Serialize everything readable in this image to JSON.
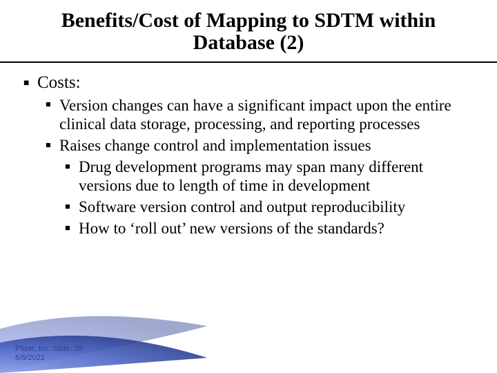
{
  "title": "Benefits/Cost of Mapping to SDTM within Database (2)",
  "section": "Costs:",
  "bullets": {
    "b1": "Version changes can have a significant impact upon the entire clinical data storage, processing, and reporting processes",
    "b2": "Raises change control and implementation issues",
    "b2a": "Drug development programs may span many different versions due to length of time in development",
    "b2b": "Software version control and output reproducibility",
    "b2c": "How to ‘roll out’ new versions of the standards?"
  },
  "footer": {
    "line1": "Pfizer, Inc. Slide: 35",
    "line2": "6/8/2021"
  }
}
